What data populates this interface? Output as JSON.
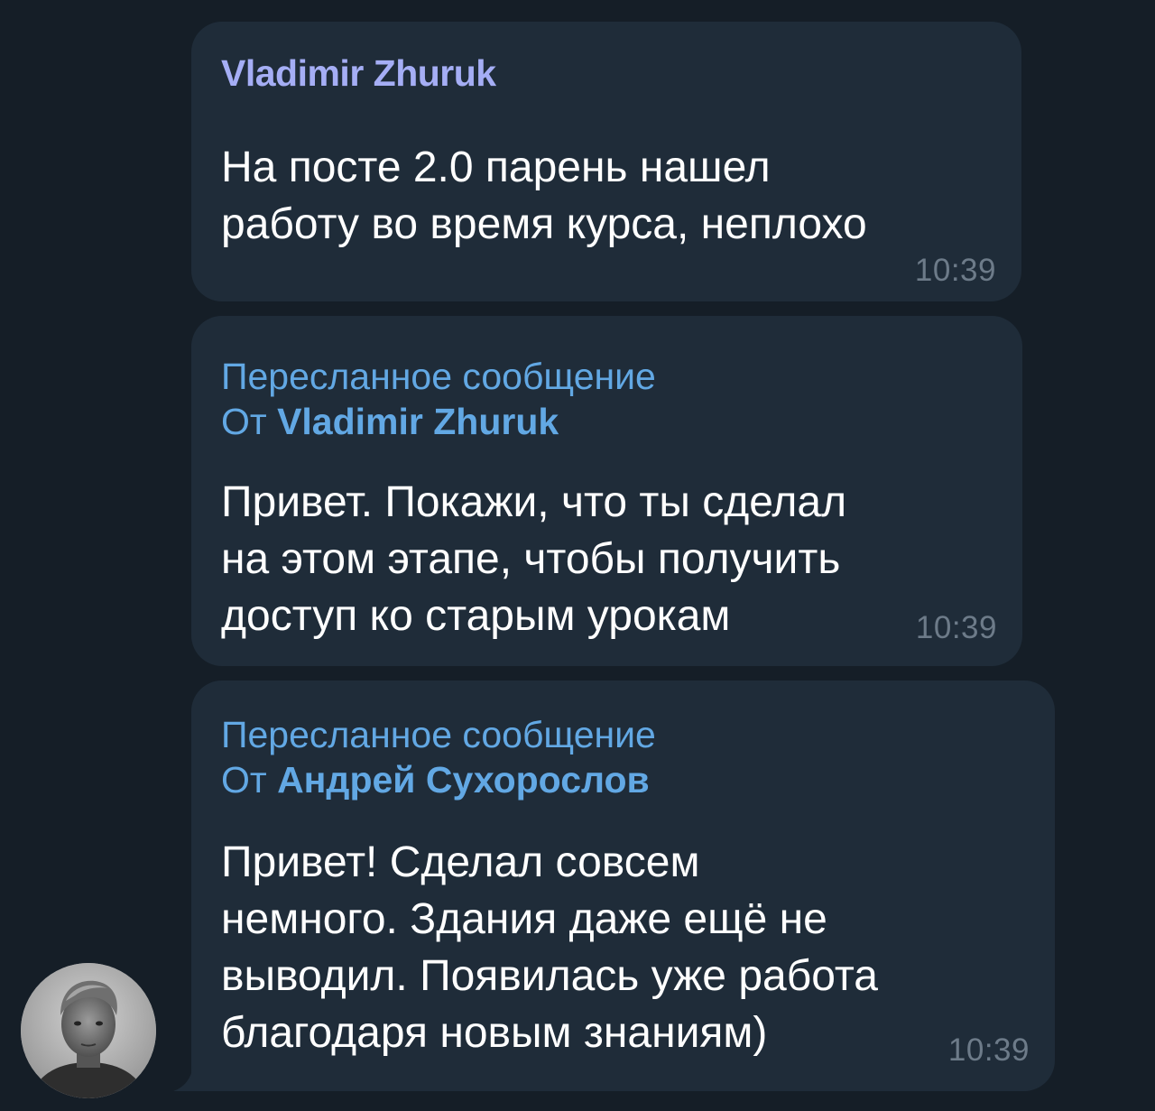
{
  "messages": [
    {
      "sender": "Vladimir Zhuruk",
      "lines": [
        "На посте 2.0 парень нашел",
        "работу во время курса, неплохо"
      ],
      "time": "10:39"
    },
    {
      "forward_label": "Пересланное сообщение",
      "from_prefix": "От ",
      "from_name": "Vladimir Zhuruk",
      "lines": [
        "Привет. Покажи, что ты сделал",
        "на этом этапе, чтобы получить",
        "доступ ко старым урокам"
      ],
      "time": "10:39"
    },
    {
      "forward_label": "Пересланное сообщение",
      "from_prefix": "От ",
      "from_name": "Андрей Сухорослов",
      "lines": [
        "Привет! Сделал совсем",
        "немного. Здания даже ещё не",
        "выводил. Появилась уже работа",
        "благодаря новым знаниям)"
      ],
      "time": "10:39"
    }
  ],
  "colors": {
    "background": "#151e27",
    "bubble": "#1f2c39",
    "sender_name": "#a5aef5",
    "forward_link": "#62a8e4",
    "message_text": "#ffffff",
    "timestamp": "#6d7b89"
  },
  "avatar": {
    "icon": "user-avatar-photo"
  }
}
